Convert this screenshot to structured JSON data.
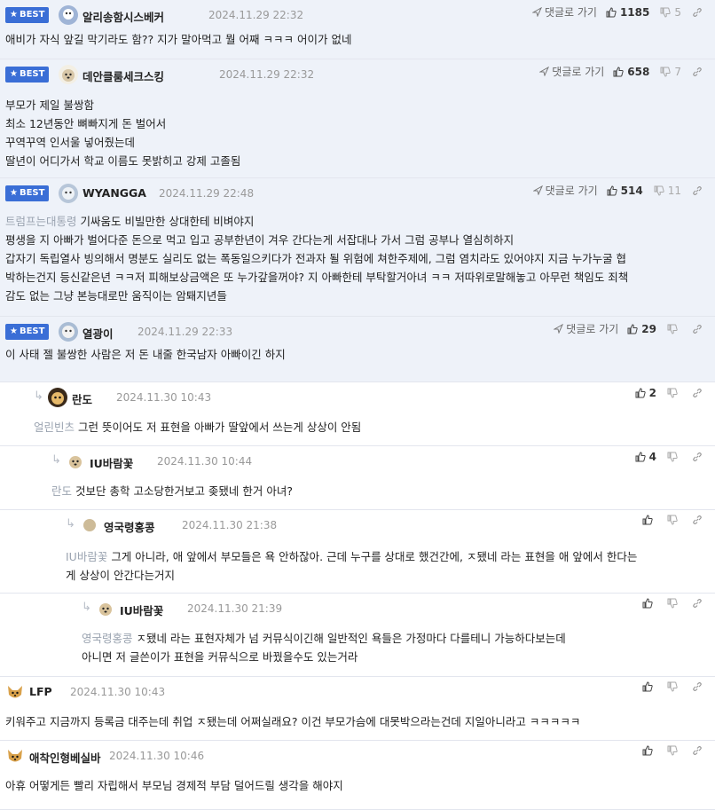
{
  "reply_button_label": "댓글로 가기",
  "best_label": "BEST",
  "comments": [
    {
      "best": true,
      "nick": "알리송함시스베커",
      "date": "2024.11.29 22:32",
      "up": "1185",
      "down": "5",
      "lines": [
        "애비가 자식 앞길 막기라도 함?? 지가 말아먹고 뭘 어째 ㅋㅋㅋ 어이가 없네"
      ]
    },
    {
      "best": true,
      "nick": "데안클룸세크스킹",
      "date": "2024.11.29 22:32",
      "up": "658",
      "down": "7",
      "lines": [
        "부모가 제일 불쌍함",
        "최소 12년동안 뼈빠지게 돈 벌어서",
        "꾸역꾸역 인서울 넣어줬는데",
        "딸년이 어디가서 학교 이름도 못밝히고 강제 고졸됨"
      ]
    },
    {
      "best": true,
      "nick": "WYANGGA",
      "date": "2024.11.29 22:48",
      "up": "514",
      "down": "11",
      "tag": "트럼프는대통령",
      "lines": [
        "기싸움도 비빌만한 상대한테 비벼야지",
        "평생을 지 아빠가 벌어다준 돈으로 먹고 입고 공부한년이 겨우 간다는게 서잡대나 가서 그럼 공부나 열심히하지",
        "갑자기 독립열사 빙의해서 명분도 실리도 없는 폭동일으키다가 전과자 될 위험에 쳐한주제에, 그럼 염치라도 있어야지 지금 누가누굴 협",
        "박하는건지 등신같은년 ㅋㅋ저 피해보상금액은 또 누가갚을꺼야? 지 아빠한테 부탁할거아녀 ㅋㅋ 저따위로말해놓고 아무런 책임도 죄책",
        "감도 없는 그냥 본능대로만 움직이는 암퇘지년들"
      ]
    },
    {
      "best": true,
      "nick": "열광이",
      "date": "2024.11.29 22:33",
      "up": "29",
      "down": "",
      "lines": [
        "이 사태 젤 불쌍한 사람은 저 돈 내줄 한국남자 아빠이긴 하지"
      ]
    },
    {
      "best": false,
      "nick": "란도",
      "date": "2024.11.30 10:43",
      "up": "2",
      "down": "",
      "tag": "얼린빈츠",
      "lines": [
        "그런 뜻이어도 저 표현을 아빠가 딸앞에서 쓰는게 상상이 안됨"
      ]
    },
    {
      "best": false,
      "nick": "IU바람꽃",
      "date": "2024.11.30 10:44",
      "up": "4",
      "down": "",
      "tag": "란도",
      "lines": [
        "것보단 총학 고소당한거보고 좆됐네 한거 아녀?"
      ]
    },
    {
      "best": false,
      "nick": "영국령홍콩",
      "date": "2024.11.30 21:38",
      "up": "",
      "down": "",
      "tag": "IU바람꽃",
      "lines": [
        "그게 아니라, 애 앞에서 부모들은 욕 안하잖아. 근데 누구를 상대로 했건간에, ㅈ됐네 라는 표현을 애 앞에서 한다는",
        "게 상상이 안간다는거지"
      ]
    },
    {
      "best": false,
      "nick": "IU바람꽃",
      "date": "2024.11.30 21:39",
      "up": "",
      "down": "",
      "tag": "영국령홍콩",
      "lines": [
        "ㅈ됐네 라는 표현자체가 넘 커뮤식이긴해 일반적인 욕들은 가정마다 다를테니 가능하다보는데",
        "아니면 저 글쓴이가 표현을 커뮤식으로 바꿨을수도 있는거라"
      ]
    },
    {
      "best": false,
      "nick": "LFP",
      "date": "2024.11.30 10:43",
      "up": "",
      "down": "",
      "lines": [
        "키워주고 지금까지 등록금 대주는데 취업 ㅈ됐는데 어쩌실래요? 이건 부모가슴에 대못박으라는건데 지일아니라고 ㅋㅋㅋㅋㅋ"
      ]
    },
    {
      "best": false,
      "nick": "애착인형베실바",
      "date": "2024.11.30 10:46",
      "up": "",
      "down": "",
      "lines": [
        "아휴 어떻게든 빨리 자립해서 부모님 경제적 부담 덜어드릴 생각을 해야지"
      ]
    }
  ]
}
